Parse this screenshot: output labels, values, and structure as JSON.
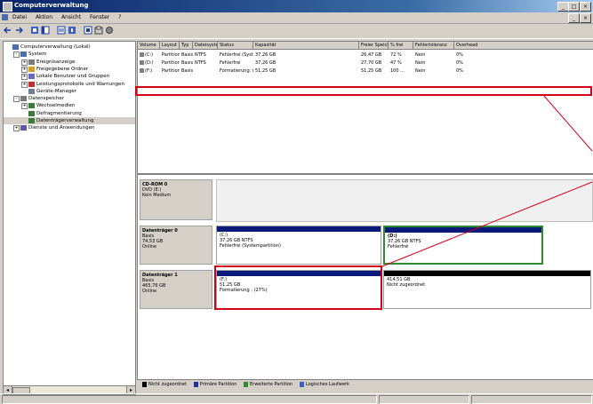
{
  "window": {
    "title": "Computerverwaltung",
    "buttons": [
      "_",
      "□",
      "×"
    ]
  },
  "menu": {
    "items": [
      "Datei",
      "Aktion",
      "Ansicht",
      "Fenster",
      "?"
    ],
    "right_buttons": [
      "_",
      "×"
    ]
  },
  "toolbar": {
    "icons": [
      "back-icon",
      "forward-icon",
      "up-icon",
      "show-hide-tree-icon",
      "properties-icon",
      "help-icon",
      "refresh-icon",
      "export-icon",
      "settings-icon"
    ]
  },
  "tree": {
    "items": [
      {
        "label": "Computerverwaltung (Lokal)",
        "level": 0,
        "expander": ""
      },
      {
        "label": "System",
        "level": 1,
        "expander": "-"
      },
      {
        "label": "Ereignisanzeige",
        "level": 2,
        "expander": "+"
      },
      {
        "label": "Freigegebene Ordner",
        "level": 2,
        "expander": "+"
      },
      {
        "label": "Lokale Benutzer und Gruppen",
        "level": 2,
        "expander": "+"
      },
      {
        "label": "Leistungsprotokolle und Warnungen",
        "level": 2,
        "expander": "+"
      },
      {
        "label": "Geräte-Manager",
        "level": 2,
        "expander": ""
      },
      {
        "label": "Datenspeicher",
        "level": 1,
        "expander": "-"
      },
      {
        "label": "Wechselmedien",
        "level": 2,
        "expander": "+"
      },
      {
        "label": "Defragmentierung",
        "level": 2,
        "expander": ""
      },
      {
        "label": "Datenträgerverwaltung",
        "level": 2,
        "expander": ""
      },
      {
        "label": "Dienste und Anwendungen",
        "level": 1,
        "expander": "+"
      }
    ]
  },
  "volume_list": {
    "columns": [
      "Volume",
      "Layout",
      "Typ",
      "Dateisystem",
      "Status",
      "Kapazität",
      "Freier Speicher",
      "% frei",
      "Fehlertoleranz",
      "Overhead"
    ],
    "rows": [
      [
        "(C:)",
        "Partition",
        "Basis",
        "NTFS",
        "Fehlerfrei (Systempartition)",
        "37,26 GB",
        "26,47 GB",
        "72 %",
        "Nein",
        "0%"
      ],
      [
        "(D:)",
        "Partition",
        "Basis",
        "NTFS",
        "Fehlerfrei",
        "37,26 GB",
        "27,70 GB",
        "47 %",
        "Nein",
        "0%"
      ],
      [
        "(F:)",
        "Partition",
        "Basis",
        "",
        "Formatierung: (27%)",
        "51,25 GB",
        "51,25 GB",
        "100 ...",
        "Nein",
        "0%"
      ]
    ]
  },
  "disks": [
    {
      "name": "CD-ROM 0",
      "lines": [
        "DVD (E:)",
        "",
        "Kein Medium"
      ]
    },
    {
      "name": "Datenträger 0",
      "lines": [
        "Basis",
        "74,53 GB",
        "Online"
      ]
    },
    {
      "name": "Datenträger 1",
      "lines": [
        "Basis",
        "465,76 GB",
        "Online"
      ]
    }
  ],
  "partitions": {
    "disk0_p1": [
      "(C:)",
      "37,26 GB NTFS",
      "Fehlerfrei (Systempartition)"
    ],
    "disk0_p2": [
      "(D:)",
      "37,26 GB NTFS",
      "Fehlerfrei"
    ],
    "disk1_p1": [
      "(F:)",
      "51,25 GB",
      "Formatierung : (27%)"
    ],
    "disk1_p2": [
      "",
      "414,51 GB",
      "Nicht zugeordnet"
    ]
  },
  "legend": [
    {
      "label": "Nicht zugeordnet",
      "color": "#000000"
    },
    {
      "label": "Primäre Partition",
      "color": "#1f2fa0"
    },
    {
      "label": "Erweiterte Partition",
      "color": "#2e8b2e"
    },
    {
      "label": "Logisches Laufwerk",
      "color": "#3d5fc4"
    }
  ],
  "colors": {
    "primary_bar": "#0a1a7a",
    "unallocated_bar": "#000000",
    "selected_border": "#2e8b2e",
    "highlight_red": "#d4001a"
  }
}
